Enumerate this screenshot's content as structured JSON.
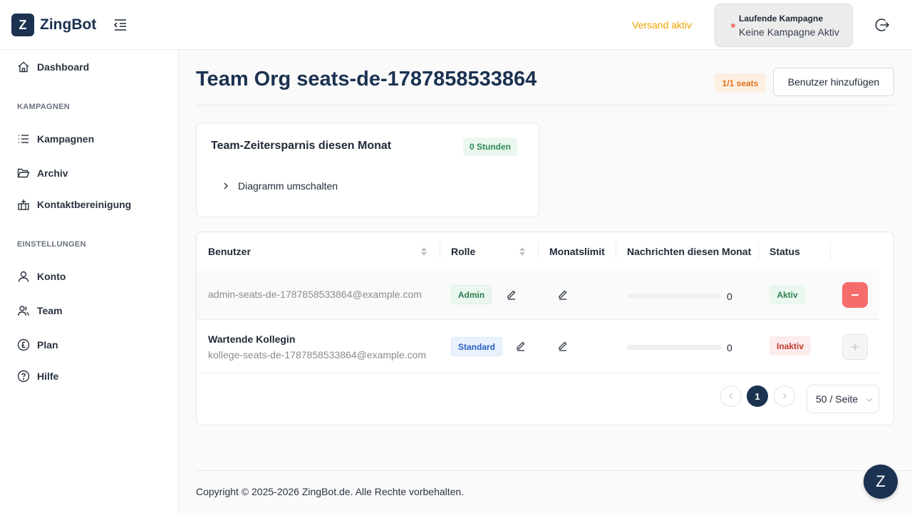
{
  "app": {
    "logo_letter": "Z",
    "name": "ZingBot"
  },
  "header": {
    "shipping_status": "Versand aktiv",
    "campaign_title": "Laufende Kampagne",
    "campaign_status": "Keine Kampagne Aktiv"
  },
  "sidebar": {
    "dashboard": "Dashboard",
    "section_campaigns": "KAMPAGNEN",
    "campaigns": "Kampagnen",
    "archive": "Archiv",
    "contact_cleanup": "Kontaktbereinigung",
    "section_settings": "EINSTELLUNGEN",
    "account": "Konto",
    "team": "Team",
    "plan": "Plan",
    "help": "Hilfe"
  },
  "page": {
    "title": "Team Org seats-de-1787858533864",
    "seats_badge": "1/1 seats",
    "add_user_label": "Benutzer hinzufügen"
  },
  "savings": {
    "title": "Team-Zeitersparnis diesen Monat",
    "hours_badge": "0 Stunden",
    "toggle_chart_label": "Diagramm umschalten"
  },
  "table": {
    "columns": {
      "user": "Benutzer",
      "role": "Rolle",
      "monthly_limit": "Monatslimit",
      "messages_month": "Nachrichten diesen Monat",
      "status": "Status"
    },
    "rows": [
      {
        "name": "",
        "email": "admin-seats-de-1787858533864@example.com",
        "role": "Admin",
        "messages": "0",
        "messages_fraction": 0,
        "status": "Aktiv"
      },
      {
        "name": "Wartende Kollegin",
        "email": "kollege-seats-de-1787858533864@example.com",
        "role": "Standard",
        "messages": "0",
        "messages_fraction": 0,
        "status": "Inaktiv"
      }
    ]
  },
  "pagination": {
    "current_page": "1",
    "page_size": "50 / Seite"
  },
  "footer": {
    "copyright": "Copyright © 2025-2026 ZingBot.de. Alle Rechte vorbehalten."
  },
  "chat": {
    "letter": "Z"
  },
  "colors": {
    "brand": "#1b3250",
    "warning": "#f0a500",
    "danger": "#f56c6c"
  }
}
